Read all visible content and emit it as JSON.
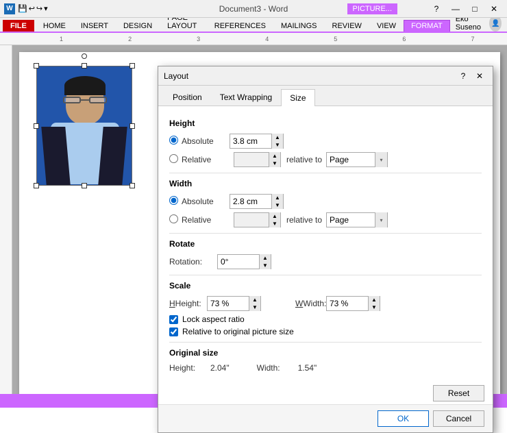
{
  "titlebar": {
    "title": "Document3 - Word",
    "picture_tab": "PICTURE...",
    "help_btn": "?",
    "min_btn": "—",
    "max_btn": "□",
    "close_btn": "✕"
  },
  "ribbon": {
    "file_tab": "FILE",
    "tabs": [
      "HOME",
      "INSERT",
      "DESIGN",
      "PAGE LAYOUT",
      "REFERENCES",
      "MAILINGS",
      "REVIEW",
      "VIEW"
    ],
    "active_tab": "FORMAT",
    "user": "Eko Suseno"
  },
  "ruler": {
    "marks": [
      "1",
      "2",
      "3",
      "4",
      "5",
      "6",
      "7"
    ]
  },
  "dialog": {
    "title": "Layout",
    "help_btn": "?",
    "close_btn": "✕",
    "tabs": [
      "Position",
      "Text Wrapping",
      "Size"
    ],
    "active_tab": "Size",
    "height_section": "Height",
    "height_absolute_label": "Absolute",
    "height_absolute_value": "3.8 cm",
    "height_relative_label": "Relative",
    "height_relative_to": "relative to",
    "height_page_option": "Page",
    "width_section": "Width",
    "width_absolute_label": "Absolute",
    "width_absolute_value": "2.8 cm",
    "width_relative_label": "Relative",
    "width_relative_to": "relative to",
    "width_page_option": "Page",
    "rotate_section": "Rotate",
    "rotation_label": "Rotation:",
    "rotation_value": "0°",
    "scale_section": "Scale",
    "scale_height_label": "Height:",
    "scale_height_value": "73 %",
    "scale_width_label": "Width:",
    "scale_width_value": "73 %",
    "lock_aspect_label": "Lock aspect ratio",
    "relative_original_label": "Relative to original picture size",
    "original_size_section": "Original size",
    "original_height_label": "Height:",
    "original_height_value": "2.04\"",
    "original_width_label": "Width:",
    "original_width_value": "1.54\"",
    "reset_btn": "Reset",
    "ok_btn": "OK",
    "cancel_btn": "Cancel"
  }
}
